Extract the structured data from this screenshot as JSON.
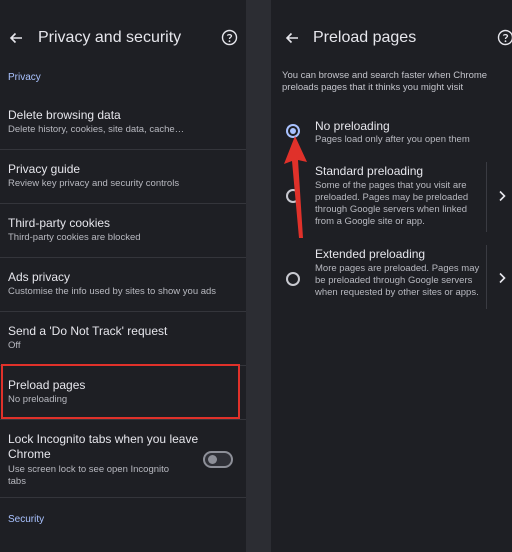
{
  "left_panel": {
    "title": "Privacy and security",
    "section_privacy": "Privacy",
    "items": [
      {
        "title": "Delete browsing data",
        "subtitle": "Delete history, cookies, site data, cache…"
      },
      {
        "title": "Privacy guide",
        "subtitle": "Review key privacy and security controls"
      },
      {
        "title": "Third-party cookies",
        "subtitle": "Third-party cookies are blocked"
      },
      {
        "title": "Ads privacy",
        "subtitle": "Customise the info used by sites to show you ads"
      },
      {
        "title": "Send a 'Do Not Track' request",
        "subtitle": "Off"
      },
      {
        "title": "Preload pages",
        "subtitle": "No preloading"
      }
    ],
    "lock_item": {
      "title_line1": "Lock Incognito tabs when you leave",
      "title_line2": "Chrome",
      "subtitle_line1": "Use screen lock to see open Incognito",
      "subtitle_line2": "tabs",
      "toggle_on": false
    },
    "section_security": "Security"
  },
  "right_panel": {
    "title": "Preload pages",
    "intro": "You can browse and search faster when Chrome preloads pages that it thinks you might visit",
    "options": [
      {
        "title": "No preloading",
        "description": "Pages load only after you open them",
        "selected": true
      },
      {
        "title": "Standard preloading",
        "description": "Some of the pages that you visit are preloaded. Pages may be preloaded through Google servers when linked from a Google site or app.",
        "selected": false
      },
      {
        "title": "Extended preloading",
        "description": "More pages are preloaded. Pages may be preloaded through Google servers when requested by other sites or apps.",
        "selected": false
      }
    ]
  },
  "colors": {
    "background": "#1e1f24",
    "accent": "#a9c2ff",
    "highlight": "#e0312a"
  },
  "icons": [
    "back-arrow-icon",
    "help-circle-icon",
    "chevron-right-icon",
    "annotation-arrow"
  ]
}
